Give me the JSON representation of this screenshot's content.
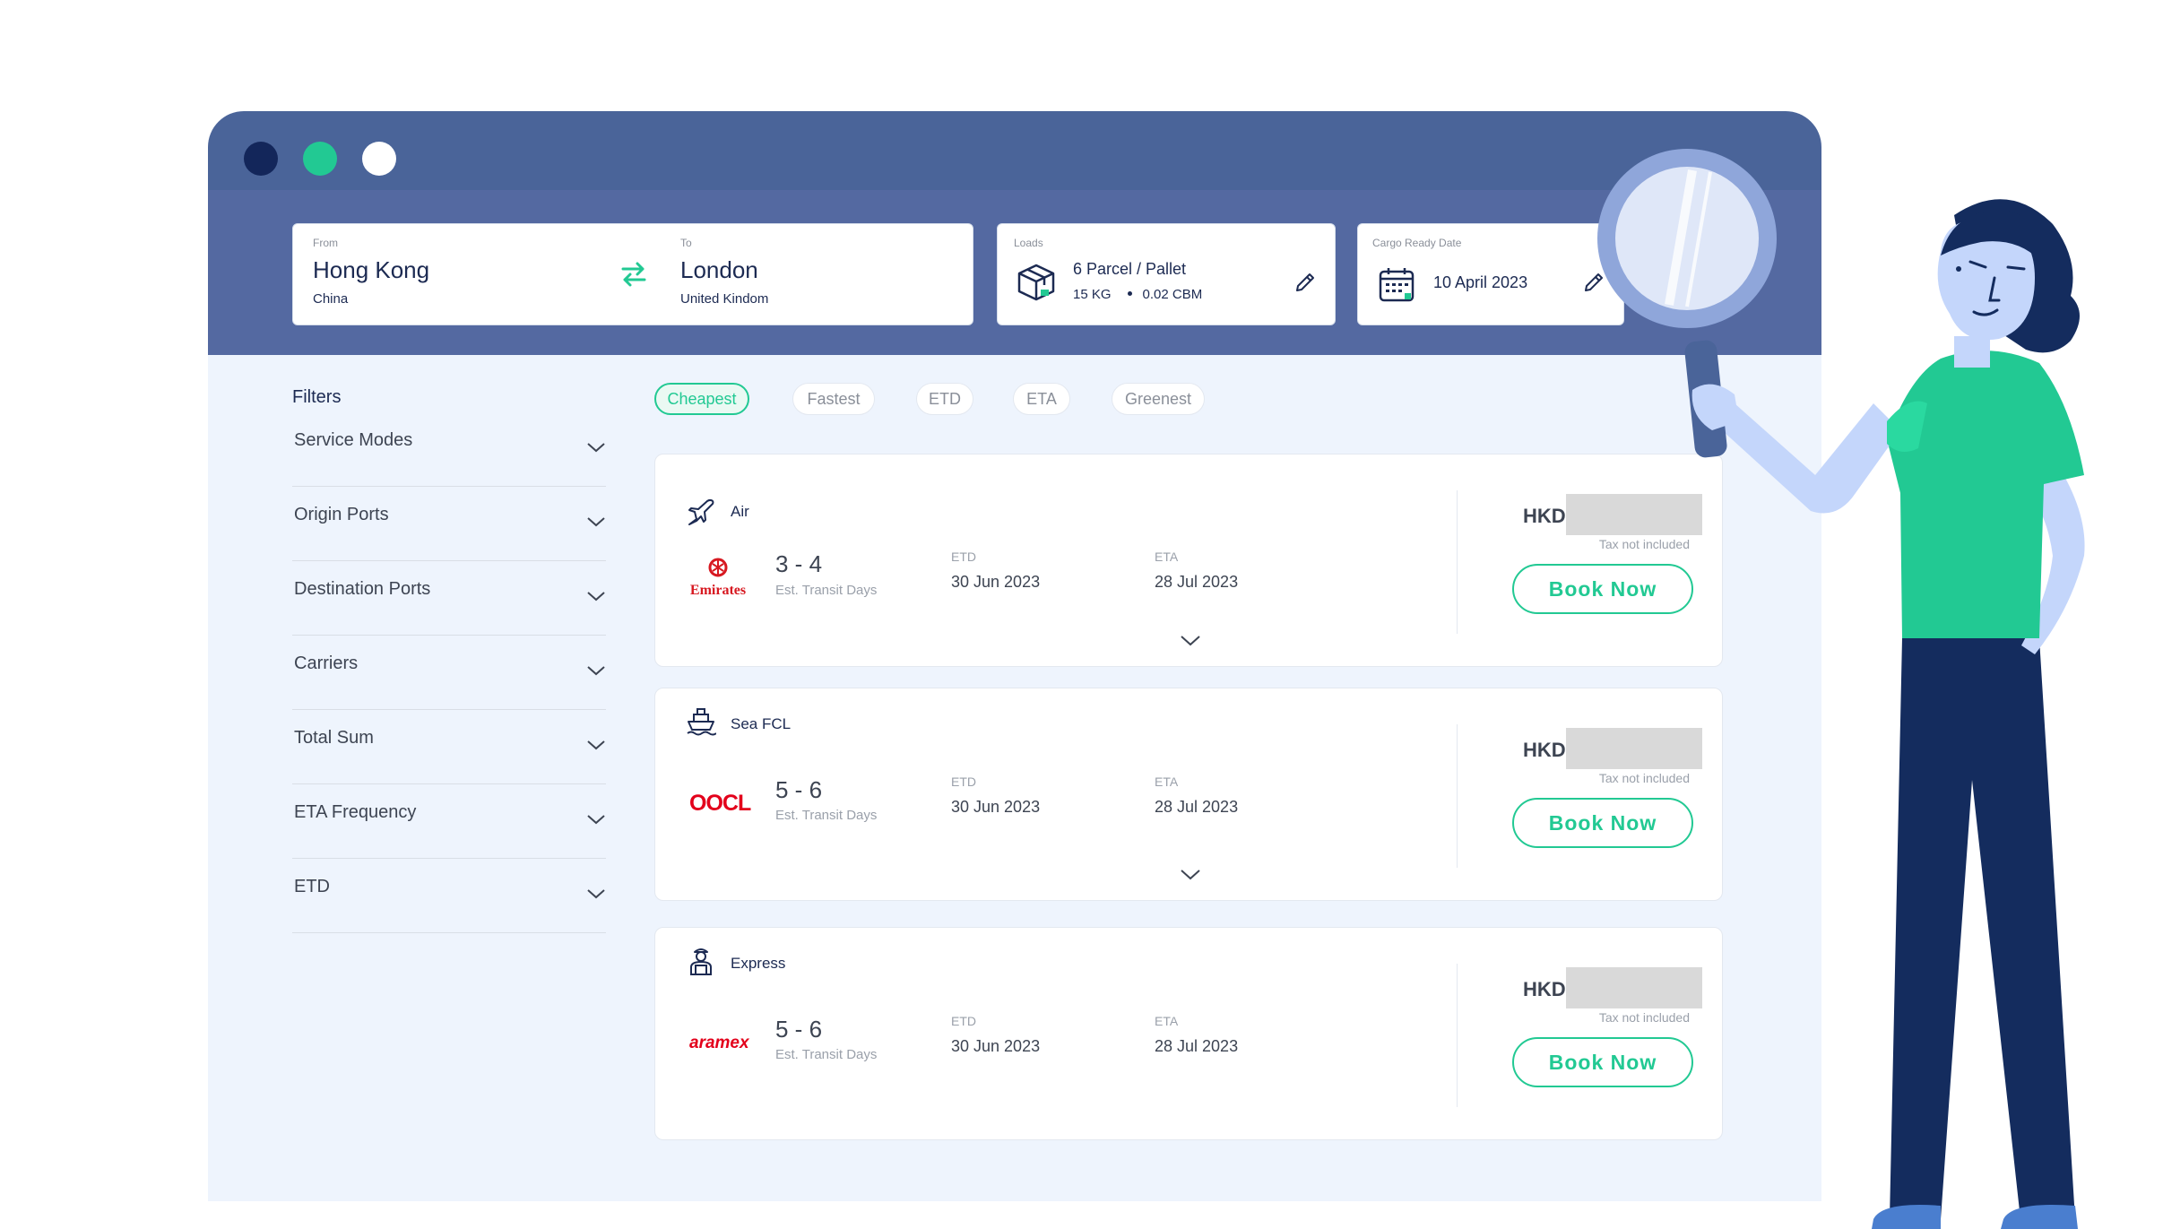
{
  "search": {
    "from_label": "From",
    "from_city": "Hong Kong",
    "from_country": "China",
    "to_label": "To",
    "to_city": "London",
    "to_country": "United Kindom",
    "loads_label": "Loads",
    "loads_main": "6 Parcel / Pallet",
    "loads_weight": "15 KG",
    "loads_volume": "0.02 CBM",
    "date_label": "Cargo Ready Date",
    "date_value": "10 April 2023"
  },
  "filters": {
    "title": "Filters",
    "items": [
      "Service Modes",
      "Origin Ports",
      "Destination Ports",
      "Carriers",
      "Total Sum",
      "ETA Frequency",
      "ETD"
    ]
  },
  "sort_tabs": [
    "Cheapest",
    "Fastest",
    "ETD",
    "ETA",
    "Greenest"
  ],
  "results": [
    {
      "mode": "Air",
      "mode_icon": "plane-icon",
      "carrier": "Emirates",
      "transit": "3 - 4",
      "transit_label": "Est. Transit Days",
      "etd_label": "ETD",
      "etd": "30 Jun 2023",
      "eta_label": "ETA",
      "eta": "28 Jul 2023",
      "currency": "HKD",
      "tax_note": "Tax not included",
      "book_label": "Book Now"
    },
    {
      "mode": "Sea FCL",
      "mode_icon": "ship-icon",
      "carrier": "OOCL",
      "transit": "5 - 6",
      "transit_label": "Est. Transit Days",
      "etd_label": "ETD",
      "etd": "30 Jun 2023",
      "eta_label": "ETA",
      "eta": "28 Jul 2023",
      "currency": "HKD",
      "tax_note": "Tax not included",
      "book_label": "Book Now"
    },
    {
      "mode": "Express",
      "mode_icon": "courier-icon",
      "carrier": "aramex",
      "transit": "5 - 6",
      "transit_label": "Est. Transit Days",
      "etd_label": "ETD",
      "etd": "30 Jun 2023",
      "eta_label": "ETA",
      "eta": "28 Jul 2023",
      "currency": "HKD",
      "tax_note": "Tax not included",
      "book_label": "Book Now"
    }
  ],
  "colors": {
    "accent": "#22c993",
    "header": "#5469a1",
    "titlebar": "#4a6499",
    "navy": "#1c2a52"
  }
}
